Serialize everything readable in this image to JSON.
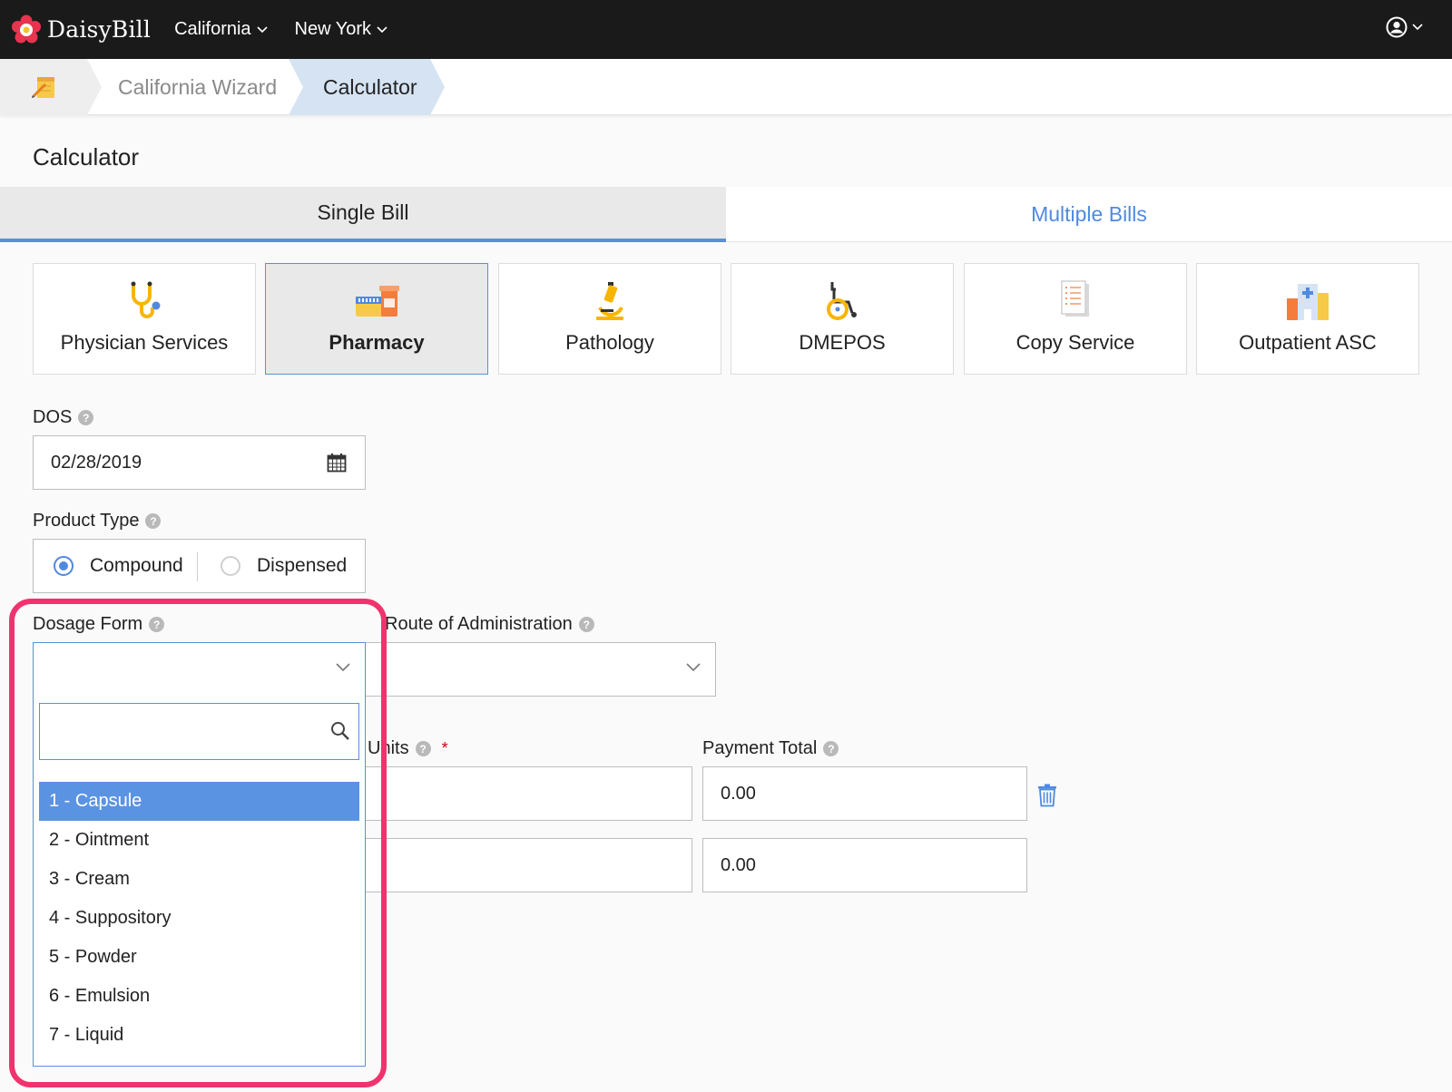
{
  "header": {
    "logo_text": "DaisyBill",
    "nav": [
      {
        "label": "California"
      },
      {
        "label": "New York"
      }
    ]
  },
  "breadcrumb": {
    "items": [
      "California Wizard",
      "Calculator"
    ]
  },
  "page": {
    "title": "Calculator"
  },
  "tabs": {
    "single": "Single Bill",
    "multiple": "Multiple Bills",
    "active": "single"
  },
  "services": [
    {
      "label": "Physician Services",
      "icon": "stethoscope-icon"
    },
    {
      "label": "Pharmacy",
      "icon": "pharmacy-icon",
      "active": true
    },
    {
      "label": "Pathology",
      "icon": "microscope-icon"
    },
    {
      "label": "DMEPOS",
      "icon": "wheelchair-icon"
    },
    {
      "label": "Copy Service",
      "icon": "document-icon"
    },
    {
      "label": "Outpatient ASC",
      "icon": "hospital-icon"
    }
  ],
  "form": {
    "dos_label": "DOS",
    "dos_value": "02/28/2019",
    "product_type_label": "Product Type",
    "product_types": [
      "Compound",
      "Dispensed"
    ],
    "product_type_selected": "Compound",
    "dosage_form_label": "Dosage Form",
    "dosage_form_value": "",
    "route_label": "Route of Administration",
    "route_value": "",
    "units_label": "Units",
    "units_required": "*",
    "payment_total_label": "Payment Total",
    "rows": [
      {
        "units": "",
        "payment_total": "0.00"
      },
      {
        "units": "",
        "payment_total": "0.00"
      }
    ]
  },
  "dosage_dropdown": {
    "search_value": "",
    "options": [
      "1 - Capsule",
      "2 - Ointment",
      "3 - Cream",
      "4 - Suppository",
      "5 - Powder",
      "6 - Emulsion",
      "7 - Liquid"
    ],
    "selected_index": 0
  },
  "colors": {
    "nav_bg": "#1a1a1a",
    "accent": "#5b8fd9",
    "link_blue": "#4f8ae0",
    "highlight": "#f0336e",
    "crumb_active": "#d6e3f2"
  }
}
